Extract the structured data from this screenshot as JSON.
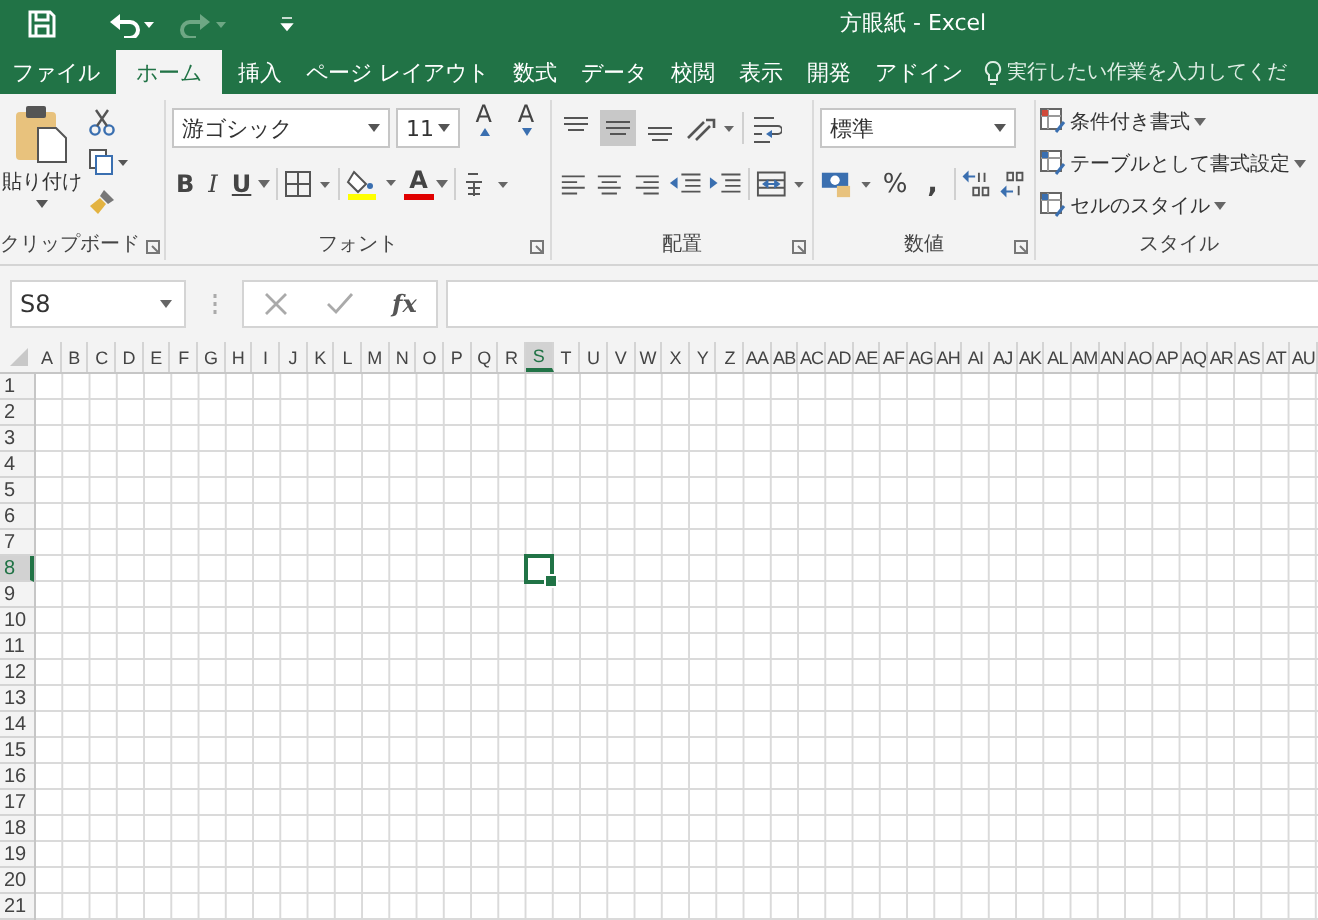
{
  "window": {
    "title": "方眼紙 - Excel"
  },
  "quick_access": [
    {
      "kind": "save",
      "disabled": false
    },
    {
      "kind": "undo",
      "disabled": false
    },
    {
      "kind": "redo",
      "disabled": true
    },
    {
      "kind": "customize",
      "disabled": false
    }
  ],
  "tabs": [
    {
      "label": "ファイル",
      "selected": false
    },
    {
      "label": "ホーム",
      "selected": true
    },
    {
      "label": "挿入",
      "selected": false
    },
    {
      "label": "ページ レイアウト",
      "selected": false
    },
    {
      "label": "数式",
      "selected": false
    },
    {
      "label": "データ",
      "selected": false
    },
    {
      "label": "校閲",
      "selected": false
    },
    {
      "label": "表示",
      "selected": false
    },
    {
      "label": "開発",
      "selected": false
    },
    {
      "label": "アドイン",
      "selected": false
    }
  ],
  "tell_me": {
    "placeholder": "実行したい作業を入力してくだ"
  },
  "ribbon": {
    "clipboard": {
      "label": "クリップボード",
      "paste": "貼り付け"
    },
    "font": {
      "label": "フォント",
      "font_name": "游ゴシック",
      "font_size": "11",
      "grow": "A",
      "shrink": "A",
      "bold": "B",
      "italic": "I",
      "underline": "U",
      "font_color": "A"
    },
    "alignment": {
      "label": "配置",
      "vertical": [
        {
          "kind": "top",
          "selected": false
        },
        {
          "kind": "middle",
          "selected": true
        },
        {
          "kind": "bottom",
          "selected": false
        }
      ]
    },
    "number": {
      "label": "数値",
      "format": "標準",
      "percent": "%",
      "comma": ","
    },
    "styles": {
      "label": "スタイル",
      "items": [
        "条件付き書式",
        "テーブルとして書式設定",
        "セルのスタイル"
      ]
    }
  },
  "formula_bar": {
    "name_box": "S8",
    "fx": "fx"
  },
  "sheet": {
    "columns": [
      {
        "label": "A",
        "selected": false
      },
      {
        "label": "B",
        "selected": false
      },
      {
        "label": "C",
        "selected": false
      },
      {
        "label": "D",
        "selected": false
      },
      {
        "label": "E",
        "selected": false
      },
      {
        "label": "F",
        "selected": false
      },
      {
        "label": "G",
        "selected": false
      },
      {
        "label": "H",
        "selected": false
      },
      {
        "label": "I",
        "selected": false
      },
      {
        "label": "J",
        "selected": false
      },
      {
        "label": "K",
        "selected": false
      },
      {
        "label": "L",
        "selected": false
      },
      {
        "label": "M",
        "selected": false
      },
      {
        "label": "N",
        "selected": false
      },
      {
        "label": "O",
        "selected": false
      },
      {
        "label": "P",
        "selected": false
      },
      {
        "label": "Q",
        "selected": false
      },
      {
        "label": "R",
        "selected": false
      },
      {
        "label": "S",
        "selected": true
      },
      {
        "label": "T",
        "selected": false
      },
      {
        "label": "U",
        "selected": false
      },
      {
        "label": "V",
        "selected": false
      },
      {
        "label": "W",
        "selected": false
      },
      {
        "label": "X",
        "selected": false
      },
      {
        "label": "Y",
        "selected": false
      },
      {
        "label": "Z",
        "selected": false
      },
      {
        "label": "AA",
        "selected": false
      },
      {
        "label": "AB",
        "selected": false
      },
      {
        "label": "AC",
        "selected": false
      },
      {
        "label": "AD",
        "selected": false
      },
      {
        "label": "AE",
        "selected": false
      },
      {
        "label": "AF",
        "selected": false
      },
      {
        "label": "AG",
        "selected": false
      },
      {
        "label": "AH",
        "selected": false
      },
      {
        "label": "AI",
        "selected": false
      },
      {
        "label": "AJ",
        "selected": false
      },
      {
        "label": "AK",
        "selected": false
      },
      {
        "label": "AL",
        "selected": false
      },
      {
        "label": "AM",
        "selected": false
      },
      {
        "label": "AN",
        "selected": false
      },
      {
        "label": "AO",
        "selected": false
      },
      {
        "label": "AP",
        "selected": false
      },
      {
        "label": "AQ",
        "selected": false
      },
      {
        "label": "AR",
        "selected": false
      },
      {
        "label": "AS",
        "selected": false
      },
      {
        "label": "AT",
        "selected": false
      },
      {
        "label": "AU",
        "selected": false
      }
    ],
    "rows": [
      {
        "label": "1",
        "selected": false
      },
      {
        "label": "2",
        "selected": false
      },
      {
        "label": "3",
        "selected": false
      },
      {
        "label": "4",
        "selected": false
      },
      {
        "label": "5",
        "selected": false
      },
      {
        "label": "6",
        "selected": false
      },
      {
        "label": "7",
        "selected": false
      },
      {
        "label": "8",
        "selected": true
      },
      {
        "label": "9",
        "selected": false
      },
      {
        "label": "10",
        "selected": false
      },
      {
        "label": "11",
        "selected": false
      },
      {
        "label": "12",
        "selected": false
      },
      {
        "label": "13",
        "selected": false
      },
      {
        "label": "14",
        "selected": false
      },
      {
        "label": "15",
        "selected": false
      },
      {
        "label": "16",
        "selected": false
      },
      {
        "label": "17",
        "selected": false
      },
      {
        "label": "18",
        "selected": false
      },
      {
        "label": "19",
        "selected": false
      },
      {
        "label": "20",
        "selected": false
      },
      {
        "label": "21",
        "selected": false
      }
    ]
  }
}
